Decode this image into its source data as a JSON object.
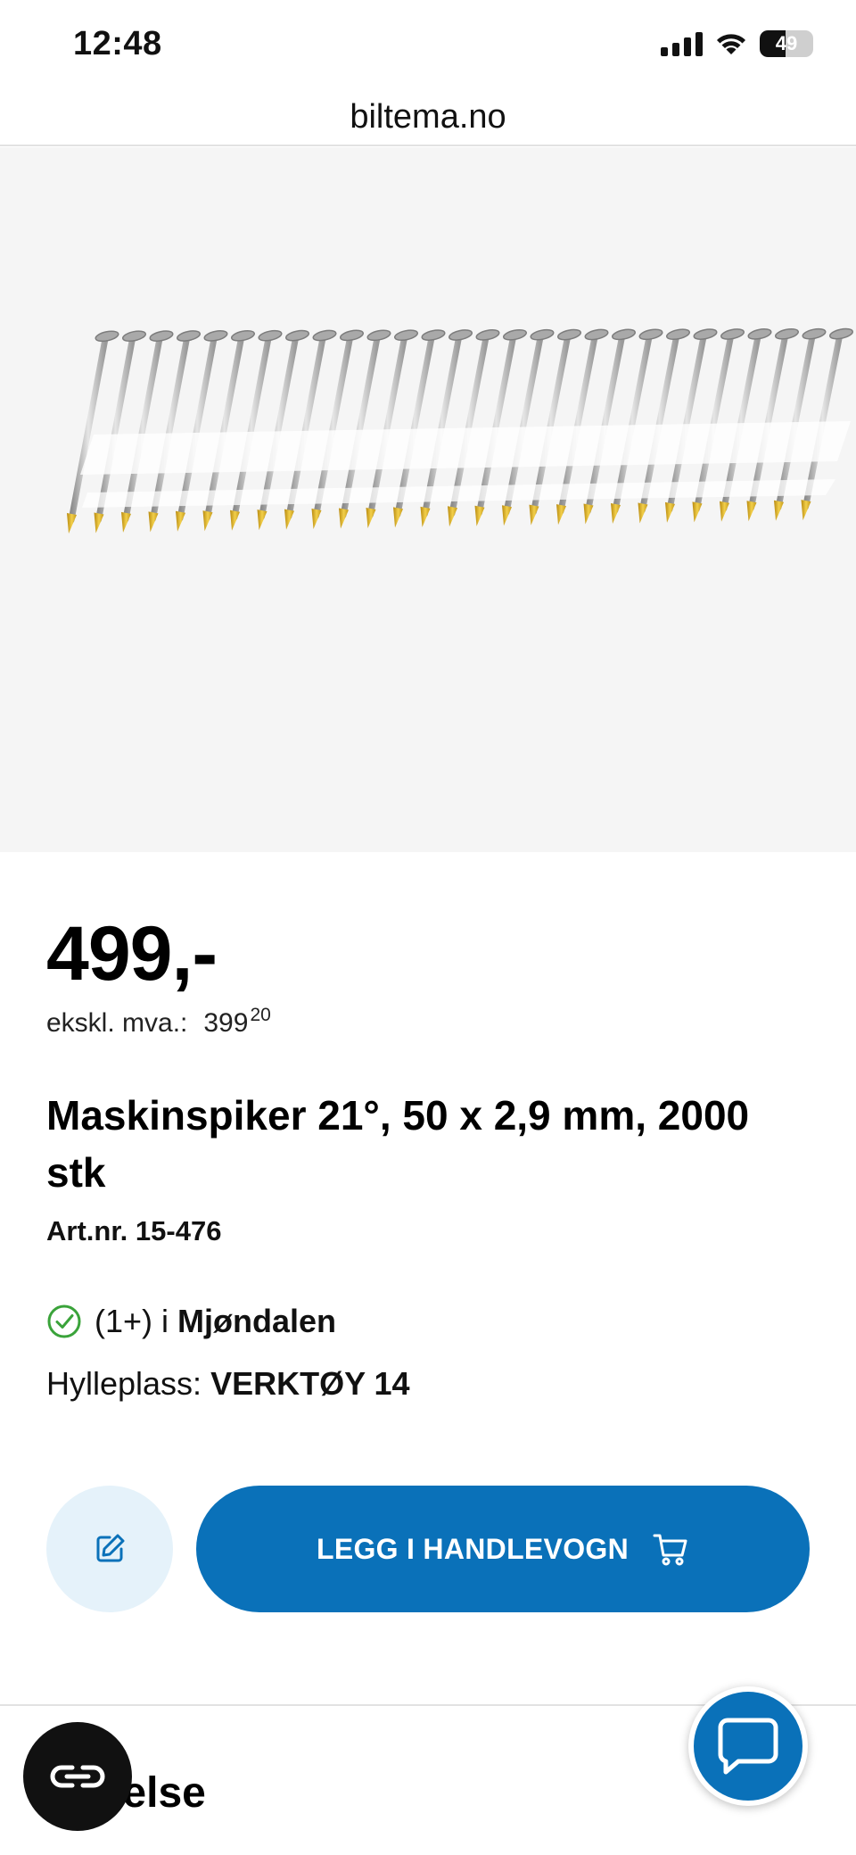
{
  "status_bar": {
    "time": "12:48",
    "battery": "49"
  },
  "browser": {
    "url": "biltema.no"
  },
  "product": {
    "price": "499,-",
    "ex_vat_label": "ekskl. mva.:",
    "ex_vat_value": "399",
    "ex_vat_decimals": "20",
    "title": "Maskinspiker 21°, 50 x 2,9 mm, 2000 stk",
    "article_number": "Art.nr. 15-476",
    "stock_count": "(1+) i",
    "stock_store": "Mjøndalen",
    "shelf_label": "Hylleplass:",
    "shelf_value": "VERKTØY 14"
  },
  "actions": {
    "add_to_cart_label": "LEGG I HANDLEVOGN"
  },
  "section": {
    "label": "krivelse"
  },
  "icons": {
    "signal": "signal-icon",
    "wifi": "wifi-icon",
    "battery": "battery-icon",
    "note": "edit-note-icon",
    "cart": "shopping-cart-icon",
    "stock_check": "check-circle-icon",
    "reader": "reader-mode-icon",
    "chat": "chat-bubble-icon"
  },
  "colors": {
    "brand_blue": "#0a71b9",
    "light_blue": "#e5f2fa",
    "stock_green": "#3aa33a",
    "image_bg": "#f5f5f5"
  }
}
